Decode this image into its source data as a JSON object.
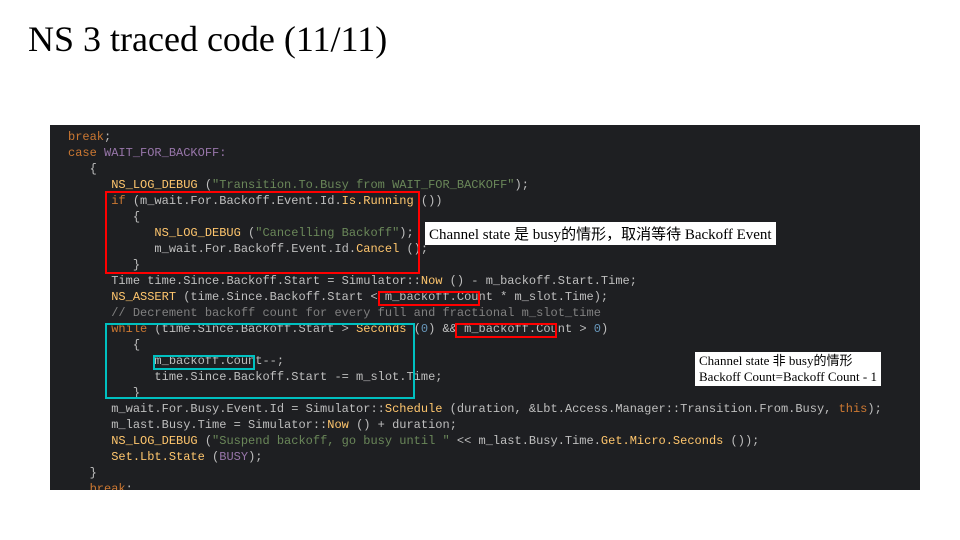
{
  "title": "NS 3 traced code (11/11)",
  "code": {
    "l0_break": "break",
    "l0_sc": ";",
    "l1_case": "case",
    "l1_const": " WAIT_FOR_BACKOFF:",
    "l2": "{",
    "l3a": "NS_LOG_DEBUG",
    "l3b": " (",
    "l3c": "\"Transition.To.Busy from WAIT_FOR_BACKOFF\"",
    "l3d": ");",
    "l4_if": "if",
    "l4b": " (m_wait.For.Backoff.Event.Id.",
    "l4fn": "Is.Running",
    "l4c": " ())",
    "l5": "{",
    "l6a": "NS_LOG_DEBUG",
    "l6b": " (",
    "l6c": "\"Cancelling Backoff\"",
    "l6d": ");",
    "l7a": "m_wait.For.Backoff.Event.Id.",
    "l7fn": "Cancel",
    "l7b": " ();",
    "l8": "}",
    "l9a": "Time time.Since.Backoff.Start = Simulator::",
    "l9fn": "Now",
    "l9b": " () - m_backoff.Start.Time;",
    "l10a": "NS_ASSERT",
    "l10b": " (time.Since.Backoff.Start < ",
    "l10hl": "m_backoff.Count",
    "l10c": " * m_slot.Time);",
    "l11": "// Decrement backoff count for every full and fractional m_slot_time",
    "l12_while": "while",
    "l12b": " (time.Since.Backoff.Start > ",
    "l12fn": "Seconds",
    "l12c": " (",
    "l12n": "0",
    "l12d": ") && ",
    "l12hl": "m_backoff.Count",
    "l12e": " > ",
    "l12n2": "0",
    "l12f": ")",
    "l13": "{",
    "l14hl": "m_backoff.Count",
    "l14b": "--;",
    "l15a": "time.Since.Backoff.Start -= m_slot.Time;",
    "l16": "}",
    "l17a": "m_wait.For.Busy.Event.Id = Simulator::",
    "l17fn": "Schedule",
    "l17b": " (duration, &Lbt.Access.Manager::Transition.From.Busy, ",
    "l17this": "this",
    "l17c": ");",
    "l18a": "m_last.Busy.Time = Simulator::",
    "l18fn": "Now",
    "l18b": " () + duration;",
    "l19a": "NS_LOG_DEBUG",
    "l19b": " (",
    "l19c": "\"Suspend backoff, go busy until \"",
    "l19d": " << m_last.Busy.Time.",
    "l19fn": "Get.Micro.Seconds",
    "l19e": " ());",
    "l20a": "Set.Lbt.State",
    "l20b": " (",
    "l20c": "BUSY",
    "l20d": ");",
    "l21": "}",
    "l22_break": "break",
    "l22b": ";"
  },
  "annot1": "Channel state 是 busy的情形，取消等待 Backoff Event",
  "annot2_l1": "Channel state 非 busy的情形",
  "annot2_l2": "Backoff Count=Backoff Count - 1"
}
